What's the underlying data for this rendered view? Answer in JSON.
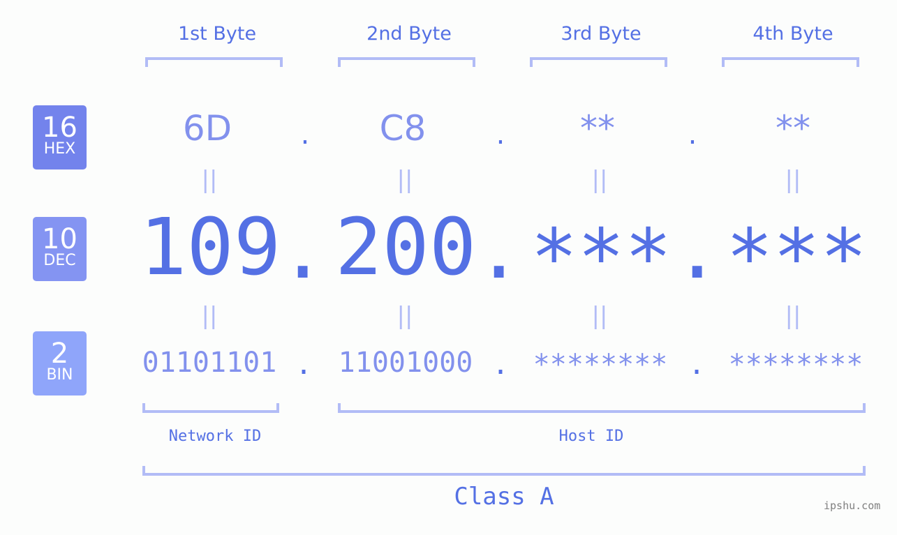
{
  "bytes": {
    "labels": [
      "1st Byte",
      "2nd Byte",
      "3rd Byte",
      "4th Byte"
    ]
  },
  "bases": {
    "hex": {
      "number": "16",
      "label": "HEX",
      "color": "#7383ec"
    },
    "dec": {
      "number": "10",
      "label": "DEC",
      "color": "#8494f2"
    },
    "bin": {
      "number": "2",
      "label": "BIN",
      "color": "#8fa5fa"
    }
  },
  "values": {
    "hex": [
      "6D",
      "C8",
      "**",
      "**"
    ],
    "dec": [
      "109",
      "200",
      "***",
      "***"
    ],
    "bin": [
      "01101101",
      "11001000",
      "********",
      "********"
    ]
  },
  "separator": ".",
  "equals": "||",
  "segments": {
    "network": "Network ID",
    "host": "Host ID",
    "class": "Class A"
  },
  "watermark": "ipshu.com",
  "colors": {
    "primary": "#5470e4",
    "light": "#8291ed",
    "bracket": "#b2bcf6"
  }
}
